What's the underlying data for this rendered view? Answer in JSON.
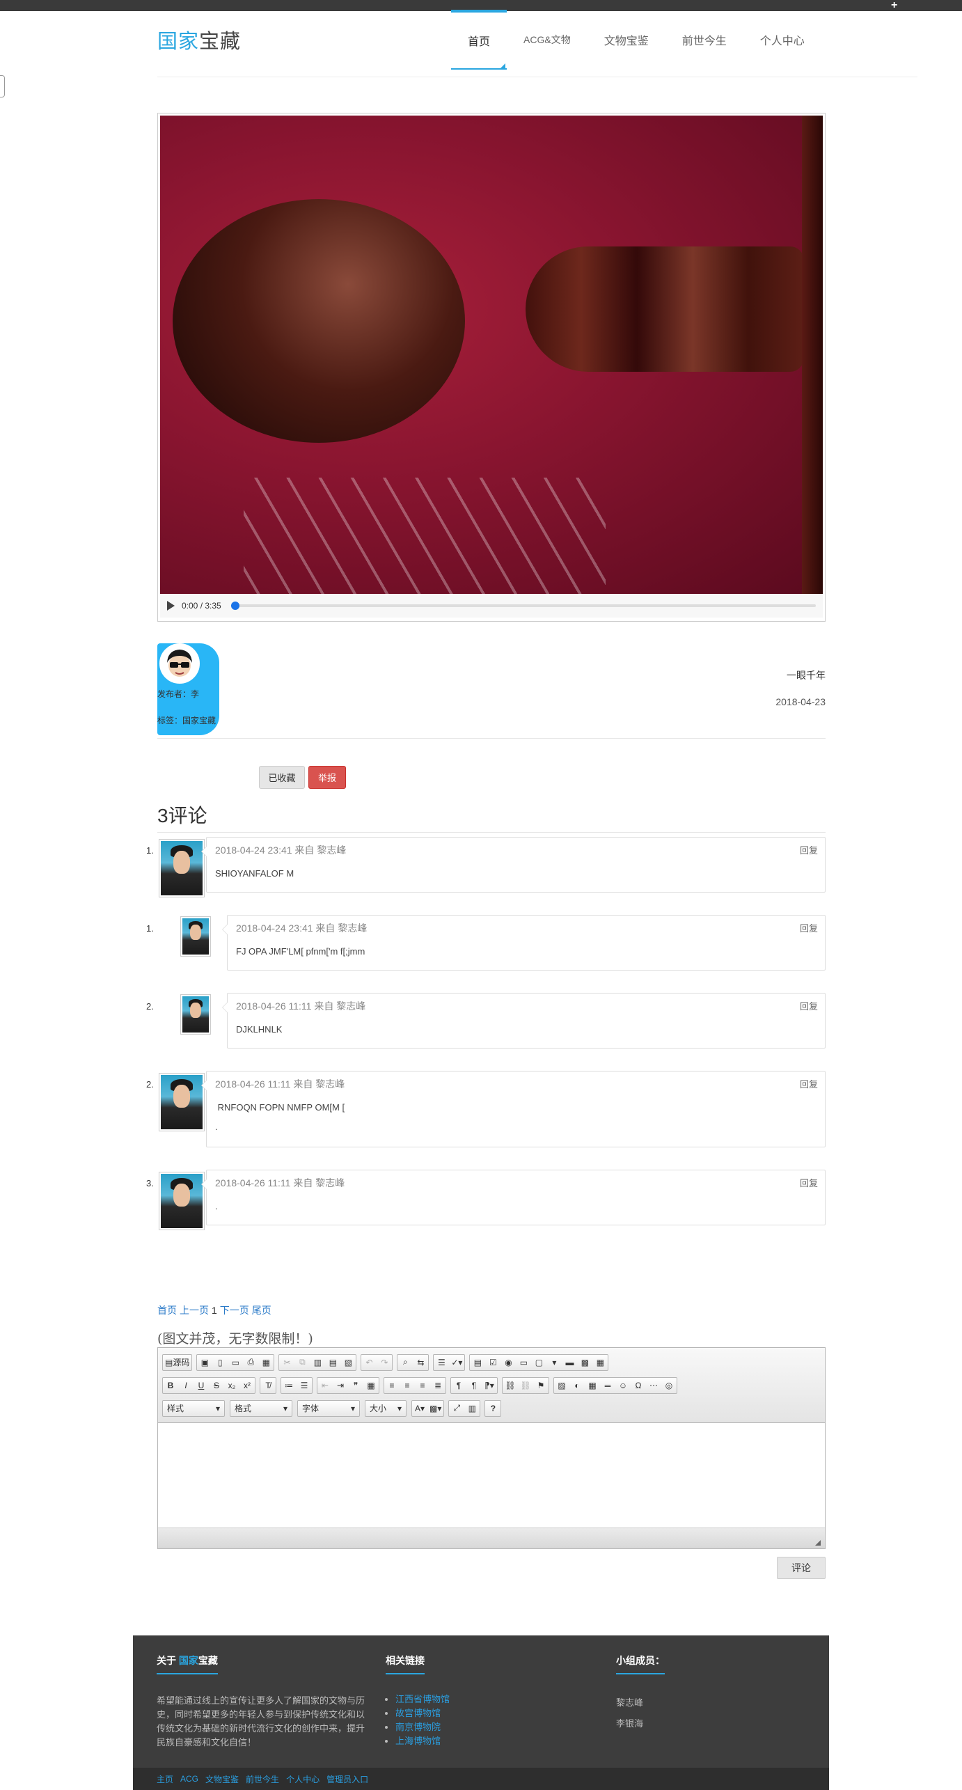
{
  "brand": {
    "logo_part1": "国家",
    "logo_part2": "宝藏"
  },
  "nav": {
    "items": [
      "首页",
      "ACG&文物",
      "文物宝鉴",
      "前世今生",
      "个人中心"
    ],
    "active": "首页"
  },
  "video": {
    "time": "0:00 / 3:35",
    "progress": 0.0
  },
  "post": {
    "publisher_label": "发布者：",
    "publisher": "李",
    "tag_label": "标签：",
    "tag": "国家宝藏",
    "title": "一眼千年",
    "date": "2018-04-23"
  },
  "actions": {
    "favorited": "已收藏",
    "report": "举报"
  },
  "comments": {
    "heading": "3评论",
    "reply_label": "回复",
    "items": [
      {
        "num": "1.",
        "meta": "2018-04-24 23:41 来自 黎志峰",
        "lines": [
          "SHIOYANFALOF M"
        ]
      },
      {
        "num": "1.",
        "meta": "2018-04-24 23:41 来自 黎志峰",
        "lines": [
          "FJ OPA JMF'LM[ pfnm['m f[;jmm"
        ]
      },
      {
        "num": "2.",
        "meta": "2018-04-26 11:11 来自 黎志峰",
        "lines": [
          "DJKLHNLK"
        ]
      },
      {
        "num": "2.",
        "meta": "2018-04-26 11:11 来自 黎志峰",
        "lines": [
          " RNFOQN FOPN NMFP OM[M [",
          "."
        ]
      },
      {
        "num": "3.",
        "meta": "2018-04-26 11:11 来自 黎志峰",
        "lines": [
          "."
        ]
      }
    ]
  },
  "pager": {
    "first": "首页",
    "prev": "上一页",
    "current": "1",
    "next": "下一页",
    "last": "尾页"
  },
  "editor": {
    "hint": "(图文并茂，无字数限制！)",
    "source_label": "源码",
    "combos": [
      "样式",
      "格式",
      "字体",
      "大小"
    ],
    "submit": "评论"
  },
  "footer": {
    "about_prefix": "关于 ",
    "about_brand1": "国家",
    "about_brand2": "宝藏",
    "about_text": "希望能通过线上的宣传让更多人了解国家的文物与历史，同时希望更多的年轻人参与到保护传统文化和以传统文化为基础的新时代流行文化的创作中来，提升民族自豪感和文化自信！",
    "links_head": "相关链接",
    "links": [
      "江西省博物馆",
      "故宫博物馆",
      "南京博物院",
      "上海博物馆"
    ],
    "members_head": "小组成员：",
    "members": [
      "黎志峰",
      "李银海"
    ],
    "bottom_links": [
      "主页",
      "ACG",
      "文物宝鉴",
      "前世今生",
      "个人中心",
      "管理员入口"
    ]
  }
}
